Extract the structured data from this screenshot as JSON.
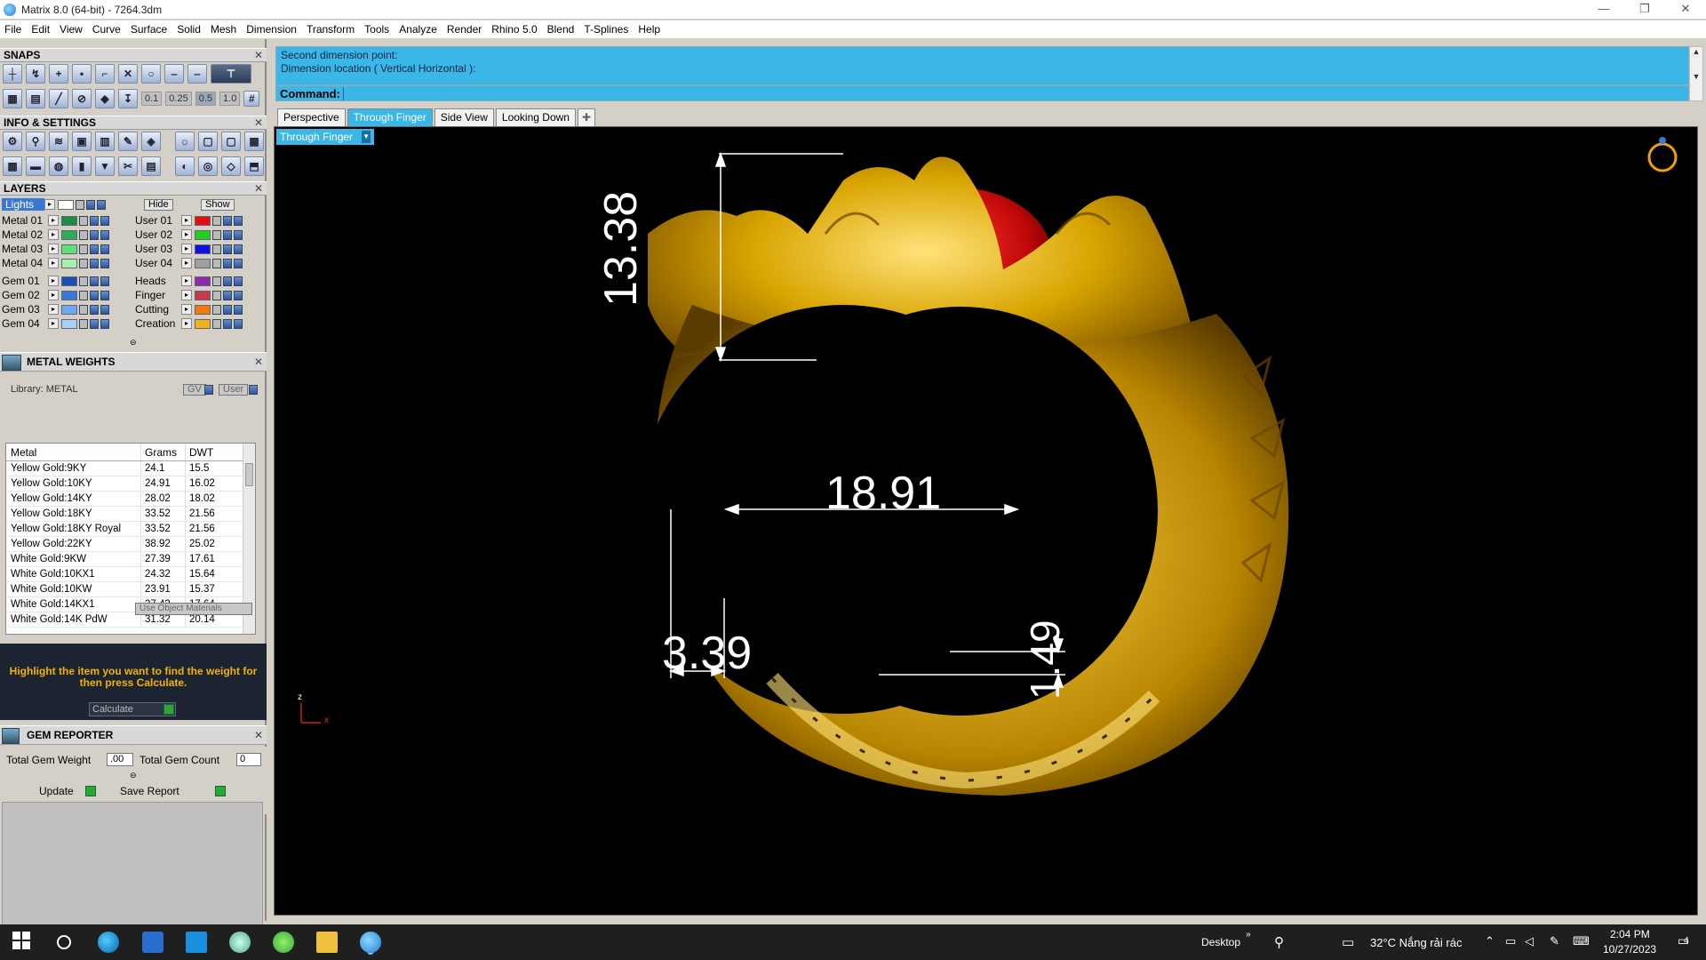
{
  "window": {
    "title": "Matrix 8.0 (64-bit) - 7264.3dm",
    "controls": [
      "—",
      "❐",
      "✕"
    ]
  },
  "menu": [
    "File",
    "Edit",
    "View",
    "Curve",
    "Surface",
    "Solid",
    "Mesh",
    "Dimension",
    "Transform",
    "Tools",
    "Analyze",
    "Render",
    "Rhino 5.0",
    "Blend",
    "T-Splines",
    "Help"
  ],
  "panels": {
    "snaps": "SNAPS",
    "info": "INFO & SETTINGS",
    "layers": "LAYERS",
    "metal_weights": "METAL WEIGHTS",
    "gem_reporter": "GEM REPORTER"
  },
  "snap_values": [
    "0.1",
    "0.25",
    "0.5",
    "1.0"
  ],
  "layers": {
    "lights": "Lights",
    "hide": "Hide",
    "show": "Show",
    "left": [
      {
        "name": "Metal 01",
        "color": "#1e8a4a"
      },
      {
        "name": "Metal 02",
        "color": "#2daa5a"
      },
      {
        "name": "Metal 03",
        "color": "#5fe07a"
      },
      {
        "name": "Metal 04",
        "color": "#a8f0b0"
      },
      {
        "name": "Gem 01",
        "color": "#1a4fb8"
      },
      {
        "name": "Gem 02",
        "color": "#3a78d8"
      },
      {
        "name": "Gem 03",
        "color": "#6ea8f0"
      },
      {
        "name": "Gem 04",
        "color": "#a8d0f8"
      }
    ],
    "right": [
      {
        "name": "User 01",
        "color": "#e01010"
      },
      {
        "name": "User 02",
        "color": "#20d020"
      },
      {
        "name": "User 03",
        "color": "#1010e0"
      },
      {
        "name": "User 04",
        "color": "#a0a0a0"
      },
      {
        "name": "Heads",
        "color": "#8a2ab0"
      },
      {
        "name": "Finger",
        "color": "#c83a4a"
      },
      {
        "name": "Cutting",
        "color": "#f07a10"
      },
      {
        "name": "Creation",
        "color": "#f0b020"
      }
    ]
  },
  "metal_weights": {
    "library": "Library: METAL",
    "gv": "GV",
    "user": "User",
    "headers": [
      "Metal",
      "Grams",
      "DWT"
    ],
    "rows": [
      [
        "Yellow Gold:9KY",
        "24.1",
        "15.5"
      ],
      [
        "Yellow Gold:10KY",
        "24.91",
        "16.02"
      ],
      [
        "Yellow Gold:14KY",
        "28.02",
        "18.02"
      ],
      [
        "Yellow Gold:18KY",
        "33.52",
        "21.56"
      ],
      [
        "Yellow Gold:18KY Royal",
        "33.52",
        "21.56"
      ],
      [
        "Yellow Gold:22KY",
        "38.92",
        "25.02"
      ],
      [
        "White Gold:9KW",
        "27.39",
        "17.61"
      ],
      [
        "White Gold:10KX1",
        "24.32",
        "15.64"
      ],
      [
        "White Gold:10KW",
        "23.91",
        "15.37"
      ],
      [
        "White Gold:14KX1",
        "27.43",
        "17.64"
      ],
      [
        "White Gold:14K PdW",
        "31.32",
        "20.14"
      ]
    ],
    "use_object_materials": "Use Object Materials",
    "hint": "Highlight the item you want to find the weight for then press Calculate.",
    "calculate": "Calculate"
  },
  "gem_reporter": {
    "total_weight_label": "Total Gem Weight",
    "total_weight": ".00",
    "total_count_label": "Total Gem Count",
    "total_count": "0",
    "update": "Update",
    "save_report": "Save Report"
  },
  "command": {
    "line1": "Second dimension point:",
    "line2": "Dimension location ( Vertical  Horizontal ):",
    "label": "Command:"
  },
  "tabs": [
    "Perspective",
    "Through Finger",
    "Side View",
    "Looking Down"
  ],
  "active_tab": "Through Finger",
  "viewport_label": "Through Finger",
  "dimensions": {
    "height": "13.38",
    "inner": "18.91",
    "band": "3.39",
    "thickness": "1.49"
  },
  "axis": {
    "z": "z",
    "x": "x"
  },
  "taskbar": {
    "desktop": "Desktop",
    "weather": "32°C  Nắng rải rác",
    "time": "2:04 PM",
    "date": "10/27/2023",
    "notification_count": "4"
  }
}
